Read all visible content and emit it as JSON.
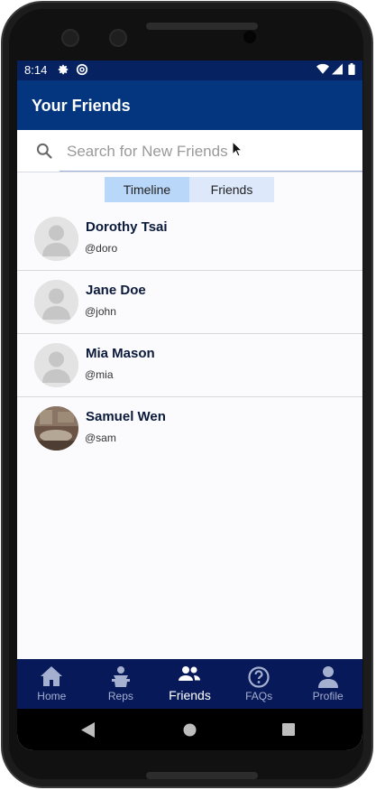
{
  "status_bar": {
    "time": "8:14",
    "icons": [
      "settings-icon",
      "at-sign-icon",
      "wifi-icon",
      "signal-icon",
      "battery-icon"
    ]
  },
  "app_bar": {
    "title": "Your Friends"
  },
  "search": {
    "placeholder": "Search for New Friends",
    "value": ""
  },
  "toggle": {
    "options": [
      "Timeline",
      "Friends"
    ],
    "selected": "Timeline"
  },
  "friends": [
    {
      "name": "Dorothy Tsai",
      "handle": "@doro",
      "avatar": "default-avatar"
    },
    {
      "name": "Jane Doe",
      "handle": "@john",
      "avatar": "default-avatar"
    },
    {
      "name": "Mia Mason",
      "handle": "@mia",
      "avatar": "default-avatar"
    },
    {
      "name": "Samuel Wen",
      "handle": "@sam",
      "avatar": "photo-avatar"
    }
  ],
  "bottom_nav": {
    "items": [
      {
        "label": "Home",
        "icon": "home-icon"
      },
      {
        "label": "Reps",
        "icon": "reps-icon"
      },
      {
        "label": "Friends",
        "icon": "friends-icon"
      },
      {
        "label": "FAQs",
        "icon": "help-circle-icon"
      },
      {
        "label": "Profile",
        "icon": "person-icon"
      }
    ],
    "active": "Friends"
  },
  "colors": {
    "app_bar": "#04367f",
    "status_bar": "#062260",
    "bottom_nav": "#08195a",
    "toggle_active": "#b9d7f9",
    "toggle_inactive": "#dde9fb"
  }
}
